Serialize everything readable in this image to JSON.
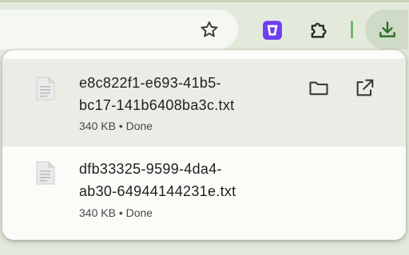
{
  "toolbar": {
    "icons": [
      "bookmark-star-icon",
      "extension-icon",
      "extensions-puzzle-icon",
      "download-icon"
    ],
    "accent": "#74b86a"
  },
  "downloads": [
    {
      "name_line1": "e8c822f1-e693-41b5-",
      "name_line2": "bc17-141b6408ba3c.txt",
      "status": "340 KB • Done"
    },
    {
      "name_line1": "dfb33325-9599-4da4-",
      "name_line2": "ab30-64944144231e.txt",
      "status": "340 KB • Done"
    }
  ]
}
